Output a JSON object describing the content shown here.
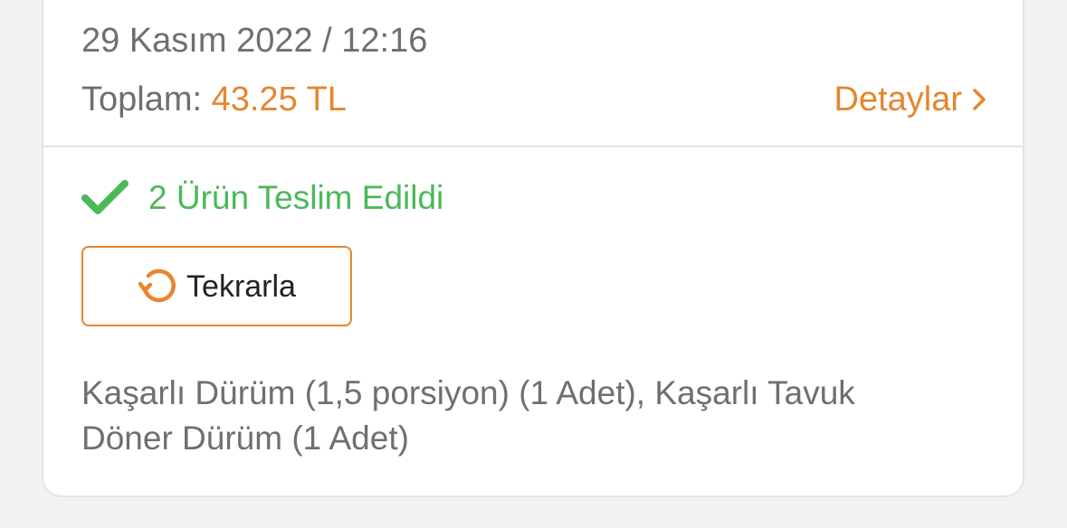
{
  "order": {
    "date_time": "29 Kasım 2022 / 12:16",
    "total_label": "Toplam:",
    "total_value": "43.25 TL",
    "details_label": "Detaylar",
    "status_text": "2 Ürün Teslim Edildi",
    "repeat_label": "Tekrarla",
    "products_line1": "Kaşarlı Dürüm (1,5 porsiyon) (1 Adet), Kaşarlı Tavuk",
    "products_line2": "Döner Dürüm (1 Adet)"
  },
  "icons": {
    "details": "chevron-right-icon",
    "status": "checkmark-icon",
    "repeat": "refresh-icon",
    "corner": "circle-button"
  },
  "colors": {
    "accent": "#e5862e",
    "success": "#4cb85a",
    "muted_text": "#6f6f6f",
    "card_background": "#ffffff",
    "page_background": "#f2f2f2"
  }
}
